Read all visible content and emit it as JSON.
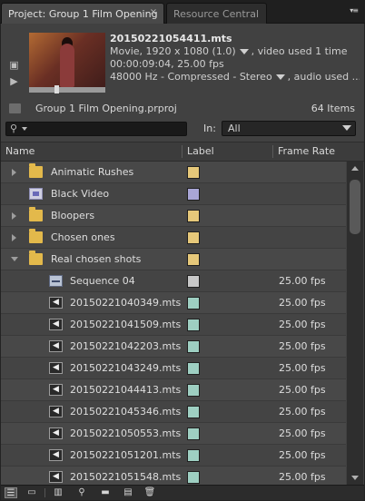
{
  "tabs": [
    {
      "label": "Project: Group 1 Film Opening",
      "close": "×"
    },
    {
      "label": "Resource Central"
    }
  ],
  "panel_menu_icon": "▾≡",
  "preview": {
    "filename": "20150221054411.mts",
    "line2_a": "Movie, 1920 x 1080 (1.0)",
    "line2_b": ", video used 1 time",
    "line3": "00:00:09:04, 25.00 fps",
    "line4_a": "48000 Hz - Compressed - Stereo",
    "line4_b": ", audio used ..."
  },
  "project": {
    "name": "Group 1 Film Opening.prproj",
    "item_count": "64 Items"
  },
  "search": {
    "in_label": "In:",
    "in_value": "All"
  },
  "columns": {
    "name": "Name",
    "label": "Label",
    "frame_rate": "Frame Rate"
  },
  "colors": {
    "yellow": "#e6c87a",
    "lavender": "#a9a6d6",
    "grey": "#c7c7c7",
    "teal": "#9ecfc2"
  },
  "items": [
    {
      "name": "Animatic Rushes",
      "icon": "folder-icon",
      "twirl": "closed",
      "label_color": "#e6c87a",
      "frame_rate": ""
    },
    {
      "name": "Black Video",
      "icon": "black-video-icon",
      "twirl": "",
      "label_color": "#a9a6d6",
      "frame_rate": ""
    },
    {
      "name": "Bloopers",
      "icon": "folder-icon",
      "twirl": "closed",
      "label_color": "#e6c87a",
      "frame_rate": ""
    },
    {
      "name": "Chosen ones",
      "icon": "folder-icon",
      "twirl": "closed",
      "label_color": "#e6c87a",
      "frame_rate": ""
    },
    {
      "name": "Real chosen shots",
      "icon": "folder-icon",
      "twirl": "open",
      "label_color": "#e6c87a",
      "frame_rate": ""
    },
    {
      "name": "Sequence 04",
      "icon": "sequence-icon",
      "twirl": "",
      "indent": true,
      "label_color": "#c7c7c7",
      "frame_rate": "25.00 fps"
    },
    {
      "name": "20150221040349.mts",
      "icon": "audio-icon",
      "twirl": "",
      "indent": true,
      "label_color": "#9ecfc2",
      "frame_rate": "25.00 fps"
    },
    {
      "name": "20150221041509.mts",
      "icon": "audio-icon",
      "twirl": "",
      "indent": true,
      "label_color": "#9ecfc2",
      "frame_rate": "25.00 fps"
    },
    {
      "name": "20150221042203.mts",
      "icon": "audio-icon",
      "twirl": "",
      "indent": true,
      "label_color": "#9ecfc2",
      "frame_rate": "25.00 fps"
    },
    {
      "name": "20150221043249.mts",
      "icon": "audio-icon",
      "twirl": "",
      "indent": true,
      "label_color": "#9ecfc2",
      "frame_rate": "25.00 fps"
    },
    {
      "name": "20150221044413.mts",
      "icon": "audio-icon",
      "twirl": "",
      "indent": true,
      "label_color": "#9ecfc2",
      "frame_rate": "25.00 fps"
    },
    {
      "name": "20150221045346.mts",
      "icon": "audio-icon",
      "twirl": "",
      "indent": true,
      "label_color": "#9ecfc2",
      "frame_rate": "25.00 fps"
    },
    {
      "name": "20150221050553.mts",
      "icon": "audio-icon",
      "twirl": "",
      "indent": true,
      "label_color": "#9ecfc2",
      "frame_rate": "25.00 fps"
    },
    {
      "name": "20150221051201.mts",
      "icon": "audio-icon",
      "twirl": "",
      "indent": true,
      "label_color": "#9ecfc2",
      "frame_rate": "25.00 fps"
    },
    {
      "name": "20150221051548.mts",
      "icon": "audio-icon",
      "twirl": "",
      "indent": true,
      "label_color": "#9ecfc2",
      "frame_rate": "25.00 fps"
    }
  ],
  "bottom_buttons": [
    "list-view-icon",
    "icon-view-icon",
    "automate-to-sequence-icon",
    "find-icon",
    "new-bin-icon",
    "new-item-icon",
    "clear-icon"
  ]
}
